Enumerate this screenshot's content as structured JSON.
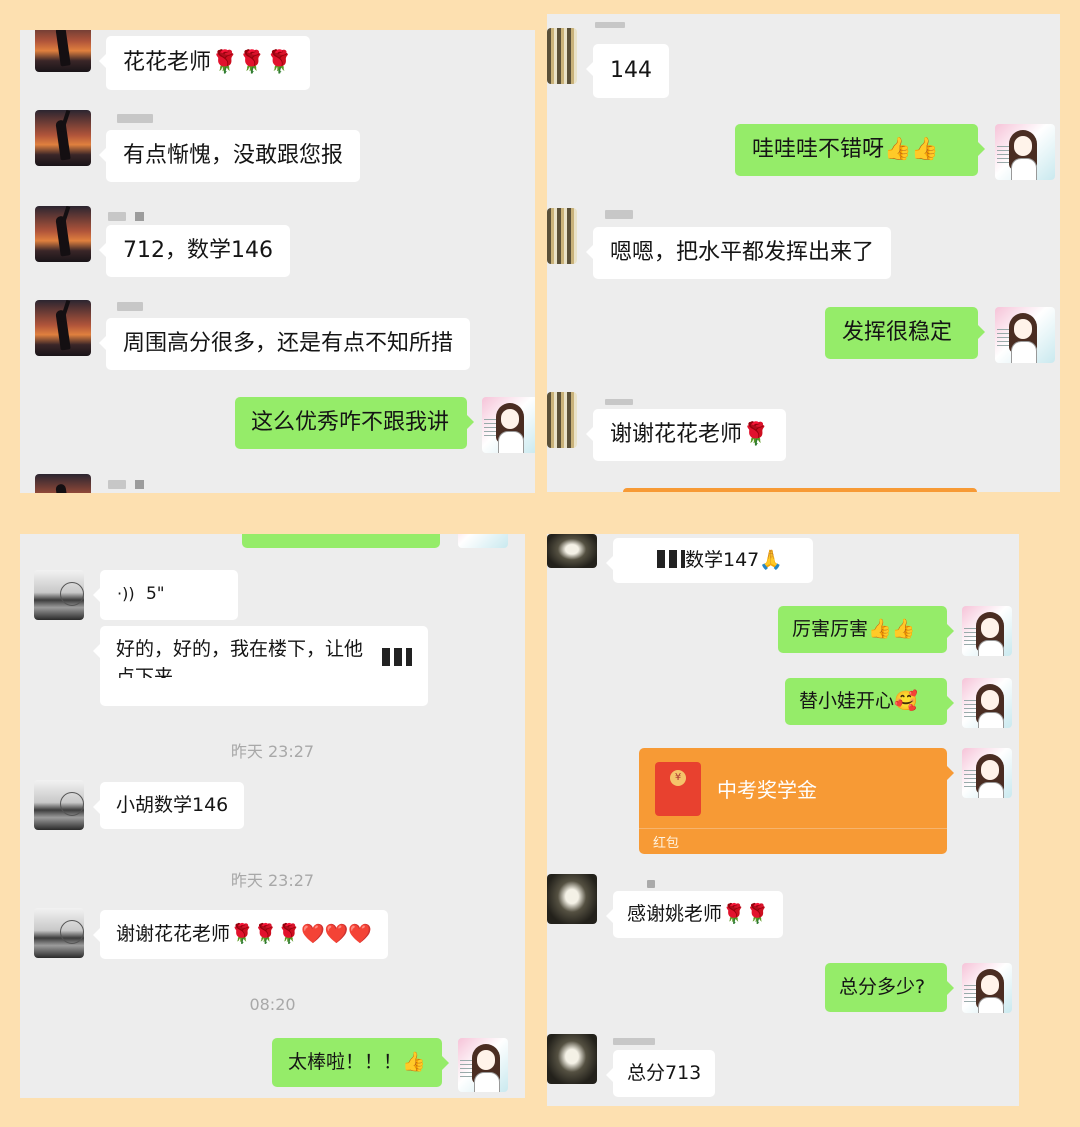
{
  "panel1": {
    "messages": [
      {
        "text": "花花老师🌹🌹🌹"
      },
      {
        "text": "有点惭愧，没敢跟您报"
      },
      {
        "text": "712，数学146"
      },
      {
        "text": "周围高分很多，还是有点不知所措"
      },
      {
        "text": "这么优秀咋不跟我讲"
      }
    ]
  },
  "panel2": {
    "messages": [
      {
        "text": "144"
      },
      {
        "text": "哇哇哇不错呀👍👍"
      },
      {
        "text": "嗯嗯，把水平都发挥出来了"
      },
      {
        "text": "发挥很稳定"
      },
      {
        "text": "谢谢花花老师🌹"
      }
    ]
  },
  "panel3": {
    "voice": {
      "icon": "voice-wave-icon",
      "duration": "5\""
    },
    "reply_line1": "好的，好的，我在楼下，让他",
    "reply_line2": "点下来",
    "timestamps": [
      "昨天 23:27",
      "昨天 23:27",
      "08:20"
    ],
    "messages": [
      {
        "text": "小胡数学146"
      },
      {
        "text": "谢谢花花老师🌹🌹🌹❤️❤️❤️"
      },
      {
        "text": "太棒啦！！！👍"
      }
    ]
  },
  "panel4": {
    "messages": [
      {
        "text": "数学147🙏"
      },
      {
        "text": "厉害厉害👍👍"
      },
      {
        "text": "替小娃开心🥰"
      },
      {
        "text": "感谢姚老师🌹🌹"
      },
      {
        "text": "总分多少?"
      },
      {
        "text": "总分713"
      }
    ],
    "red_packet": {
      "title": "中考奖学金",
      "label": "红包",
      "coin": "¥"
    }
  },
  "colors": {
    "background": "#fde0b0",
    "chat_bg": "#ededed",
    "outgoing": "#95ec69",
    "incoming": "#ffffff",
    "red_packet": "#f79a35"
  }
}
